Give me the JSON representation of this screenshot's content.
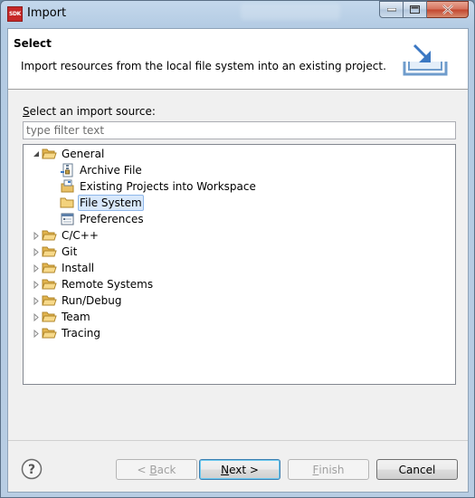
{
  "window": {
    "title": "Import",
    "app_icon_text": "SDK",
    "controls": {
      "minimize": "minimize-icon",
      "maximize": "maximize-icon",
      "close": "close-icon"
    }
  },
  "header": {
    "title": "Select",
    "description": "Import resources from the local file system into an existing project."
  },
  "source": {
    "label_mnemonic": "S",
    "label_rest": "elect an import source:",
    "filter_placeholder": "type filter text"
  },
  "tree": [
    {
      "label": "General",
      "expanded": true,
      "depth": 0,
      "icon": "folder-open-icon",
      "children": [
        {
          "label": "Archive File",
          "icon": "archive-file-icon"
        },
        {
          "label": "Existing Projects into Workspace",
          "icon": "existing-projects-icon"
        },
        {
          "label": "File System",
          "icon": "folder-icon",
          "selected": true
        },
        {
          "label": "Preferences",
          "icon": "preferences-icon"
        }
      ]
    },
    {
      "label": "C/C++",
      "icon": "folder-icon"
    },
    {
      "label": "Git",
      "icon": "folder-icon"
    },
    {
      "label": "Install",
      "icon": "folder-icon"
    },
    {
      "label": "Remote Systems",
      "icon": "folder-icon"
    },
    {
      "label": "Run/Debug",
      "icon": "folder-icon"
    },
    {
      "label": "Team",
      "icon": "folder-icon"
    },
    {
      "label": "Tracing",
      "icon": "folder-icon"
    }
  ],
  "buttons": {
    "back_prefix": "< ",
    "back_mnemonic": "B",
    "back_rest": "ack",
    "next_mnemonic": "N",
    "next_rest": "ext >",
    "finish_mnemonic": "F",
    "finish_rest": "inish",
    "cancel": "Cancel"
  },
  "colors": {
    "selection_fill": "#d8e8fb",
    "selection_border": "#8eb7ea",
    "default_button_border": "#3c7fb1"
  }
}
